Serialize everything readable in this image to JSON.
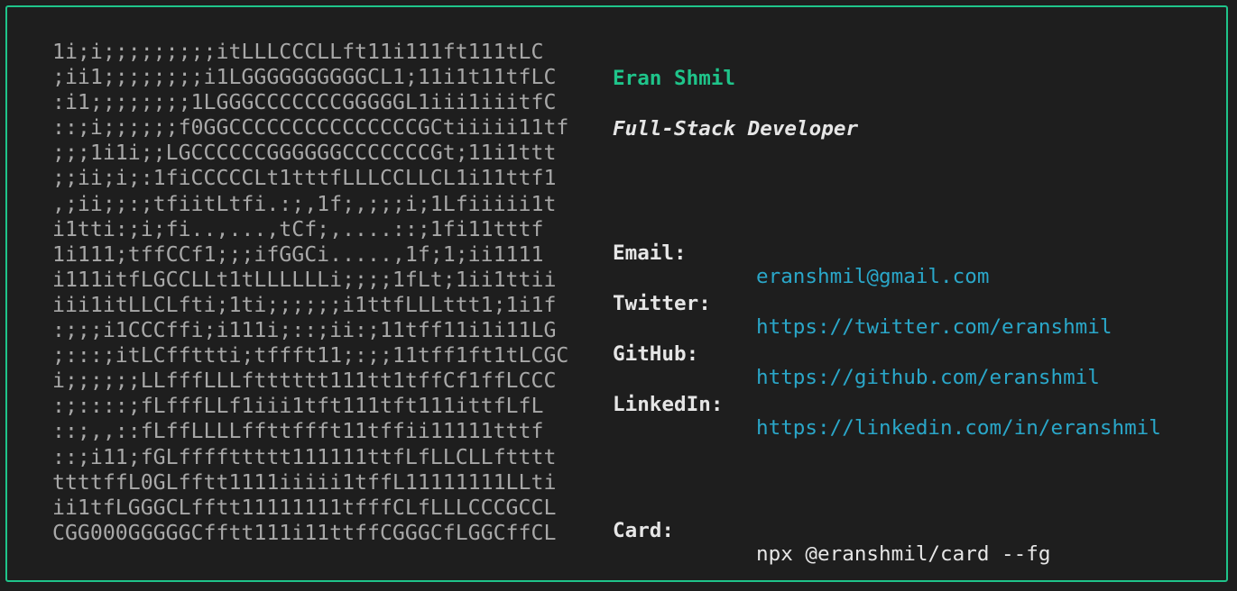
{
  "ascii_art": [
    "1i;i;;;;;;;;;itLLLCCCLLft11i111ft111tLC",
    ";ii1;;;;;;;;i1LGGGGGGGGGGCL1;11i1t11tfLC",
    ":i1;;;;;;;;1LGGGCCCCCCCGGGGGL1iii1iiitfC",
    "::;i;;;;;;f0GGCCCCCCCCCCCCCCCGCtiiiii11tf",
    ";;;1i1i;;LGCCCCCCGGGGGGCCCCCCCGt;11i1ttt",
    ";;ii;i;:1fiCCCCCLt1tttfLLLCCLLCL1i11ttf1",
    ",;ii;;:;tfiitLtfi.:;,1f;,;;;i;1Lfiiiii1t",
    "i1tti:;i;fi..,...,tCf;,....::;1fi11tttf",
    "1i111;tffCCf1;;;ifGGCi.....,1f;1;ii1111",
    "i111itfLGCCLLt1tLLLLLLi;;;;1fLt;1ii1ttii",
    "iii1itLLCLfti;1ti;;;;;;i1ttfLLLttt1;1i1f",
    ":;;;i1CCCffi;i111i;::;ii:;11tff11i1i11LG",
    ";:::;itLCffttti;tffft11;:;;11tff1ft1tLCGC",
    "i;;;;;;LLfffLLLftttttt111tt1tffCf1ffLCCC",
    ":;::::;fLfffLLf1iii1tft111tft111ittfLfL",
    "::;,,::fLffLLLLffttffft11tffii11111tttf",
    "::;i11;fGLffffttttt111111ttfLfLLCLLftttt",
    "ttttffL0GLfftt1111iiiii1tffL11111111LLti",
    "ii1tfLGGGCLfftt11111111tfffCLfLLLCCCGCCL",
    "CGG000GGGGGCfftt111i11ttffCGGGCfLGGCffCL"
  ],
  "profile": {
    "name": "Eran Shmil",
    "role": "Full-Stack Developer"
  },
  "contacts": [
    {
      "label": "Email:",
      "value": "eranshmil@gmail.com"
    },
    {
      "label": "Twitter:",
      "value": "https://twitter.com/eranshmil"
    },
    {
      "label": "GitHub:",
      "value": "https://github.com/eranshmil"
    },
    {
      "label": "LinkedIn:",
      "value": "https://linkedin.com/in/eranshmil"
    }
  ],
  "card": {
    "label": "Card:",
    "value": "npx @eranshmil/card --fg"
  },
  "colors": {
    "border": "#1fc48a",
    "name": "#1fc48a",
    "link": "#2aa7c9",
    "text": "#e6e6e6",
    "ascii_base": "#a8a8a8",
    "background": "#1e1e1e"
  }
}
